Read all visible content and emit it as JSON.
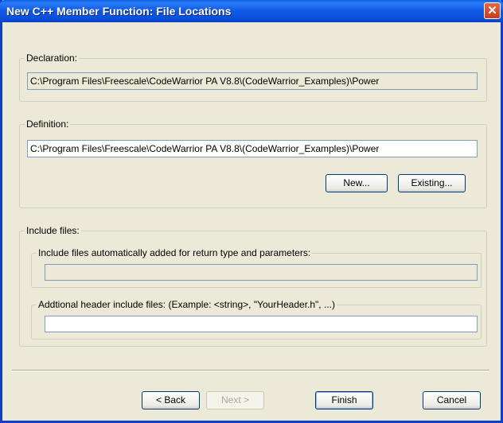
{
  "window": {
    "title": "New C++ Member Function: File Locations",
    "close_glyph": "✕"
  },
  "declaration": {
    "label": "Declaration:",
    "path": "C:\\Program Files\\Freescale\\CodeWarrior PA V8.8\\(CodeWarrior_Examples)\\Power"
  },
  "definition": {
    "label": "Definition:",
    "path": "C:\\Program Files\\Freescale\\CodeWarrior PA V8.8\\(CodeWarrior_Examples)\\Power",
    "new_label": "New...",
    "existing_label": "Existing..."
  },
  "include_files": {
    "label": "Include files:",
    "auto_label": "Include files automatically added for return type and parameters:",
    "auto_value": "",
    "additional_label": "Addtional header include files: (Example: <string>, \"YourHeader.h\", ...)",
    "additional_value": ""
  },
  "buttons": {
    "back": "< Back",
    "next": "Next >",
    "finish": "Finish",
    "cancel": "Cancel"
  }
}
